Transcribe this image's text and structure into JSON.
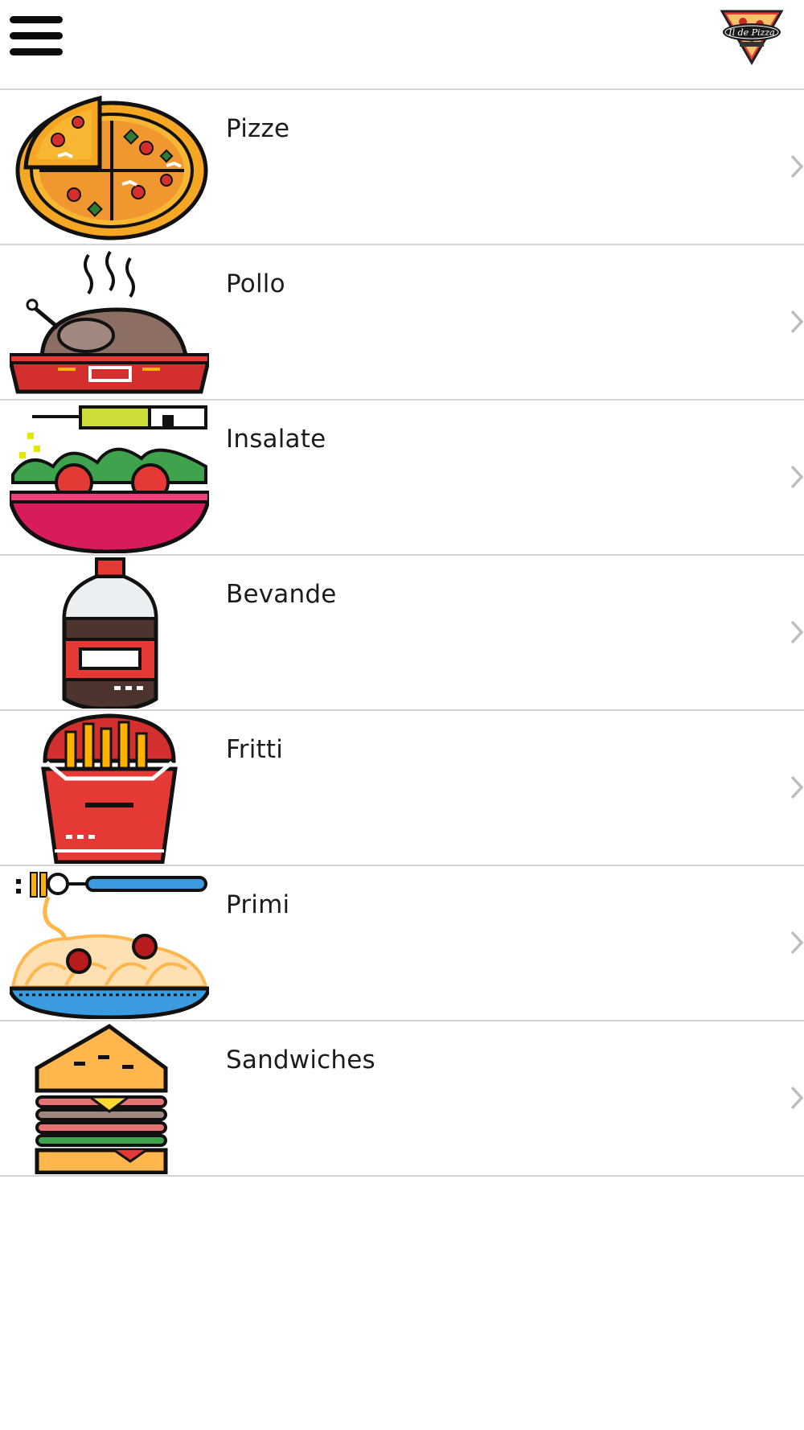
{
  "header": {
    "menu_icon": "hamburger-menu-icon",
    "logo_icon": "pizza-slice-logo-icon",
    "logo_text": "Il de Pizza"
  },
  "categories": [
    {
      "label": "Pizze",
      "icon": "pizza-icon"
    },
    {
      "label": "Pollo",
      "icon": "roast-chicken-icon"
    },
    {
      "label": "Insalate",
      "icon": "salad-bowl-icon"
    },
    {
      "label": "Bevande",
      "icon": "soda-bottle-icon"
    },
    {
      "label": "Fritti",
      "icon": "french-fries-icon"
    },
    {
      "label": "Primi",
      "icon": "spaghetti-icon"
    },
    {
      "label": "Sandwiches",
      "icon": "sandwich-icon"
    }
  ],
  "colors": {
    "divider": "#d4d4d4",
    "text": "#1c1c1c",
    "chevron": "#bdbdbd",
    "pizza_crust": "#f5a623",
    "tray_red": "#e02b2b",
    "salad_green": "#3fa34d",
    "bowl_pink": "#d81b5c",
    "plate_blue": "#3a9be0"
  }
}
